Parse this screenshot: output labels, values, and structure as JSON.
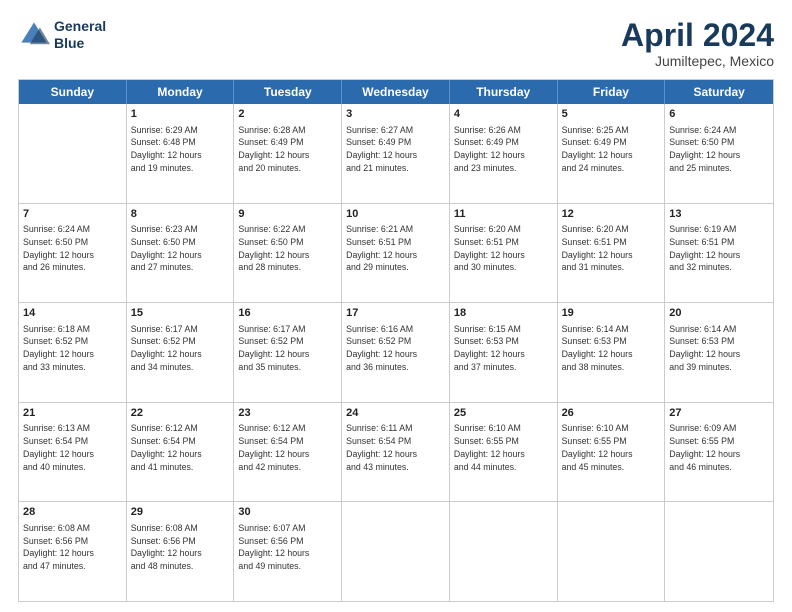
{
  "header": {
    "logo_line1": "General",
    "logo_line2": "Blue",
    "month_title": "April 2024",
    "location": "Jumiltepec, Mexico"
  },
  "day_headers": [
    "Sunday",
    "Monday",
    "Tuesday",
    "Wednesday",
    "Thursday",
    "Friday",
    "Saturday"
  ],
  "weeks": [
    [
      {
        "num": "",
        "info": ""
      },
      {
        "num": "1",
        "info": "Sunrise: 6:29 AM\nSunset: 6:48 PM\nDaylight: 12 hours\nand 19 minutes."
      },
      {
        "num": "2",
        "info": "Sunrise: 6:28 AM\nSunset: 6:49 PM\nDaylight: 12 hours\nand 20 minutes."
      },
      {
        "num": "3",
        "info": "Sunrise: 6:27 AM\nSunset: 6:49 PM\nDaylight: 12 hours\nand 21 minutes."
      },
      {
        "num": "4",
        "info": "Sunrise: 6:26 AM\nSunset: 6:49 PM\nDaylight: 12 hours\nand 23 minutes."
      },
      {
        "num": "5",
        "info": "Sunrise: 6:25 AM\nSunset: 6:49 PM\nDaylight: 12 hours\nand 24 minutes."
      },
      {
        "num": "6",
        "info": "Sunrise: 6:24 AM\nSunset: 6:50 PM\nDaylight: 12 hours\nand 25 minutes."
      }
    ],
    [
      {
        "num": "7",
        "info": "Sunrise: 6:24 AM\nSunset: 6:50 PM\nDaylight: 12 hours\nand 26 minutes."
      },
      {
        "num": "8",
        "info": "Sunrise: 6:23 AM\nSunset: 6:50 PM\nDaylight: 12 hours\nand 27 minutes."
      },
      {
        "num": "9",
        "info": "Sunrise: 6:22 AM\nSunset: 6:50 PM\nDaylight: 12 hours\nand 28 minutes."
      },
      {
        "num": "10",
        "info": "Sunrise: 6:21 AM\nSunset: 6:51 PM\nDaylight: 12 hours\nand 29 minutes."
      },
      {
        "num": "11",
        "info": "Sunrise: 6:20 AM\nSunset: 6:51 PM\nDaylight: 12 hours\nand 30 minutes."
      },
      {
        "num": "12",
        "info": "Sunrise: 6:20 AM\nSunset: 6:51 PM\nDaylight: 12 hours\nand 31 minutes."
      },
      {
        "num": "13",
        "info": "Sunrise: 6:19 AM\nSunset: 6:51 PM\nDaylight: 12 hours\nand 32 minutes."
      }
    ],
    [
      {
        "num": "14",
        "info": "Sunrise: 6:18 AM\nSunset: 6:52 PM\nDaylight: 12 hours\nand 33 minutes."
      },
      {
        "num": "15",
        "info": "Sunrise: 6:17 AM\nSunset: 6:52 PM\nDaylight: 12 hours\nand 34 minutes."
      },
      {
        "num": "16",
        "info": "Sunrise: 6:17 AM\nSunset: 6:52 PM\nDaylight: 12 hours\nand 35 minutes."
      },
      {
        "num": "17",
        "info": "Sunrise: 6:16 AM\nSunset: 6:52 PM\nDaylight: 12 hours\nand 36 minutes."
      },
      {
        "num": "18",
        "info": "Sunrise: 6:15 AM\nSunset: 6:53 PM\nDaylight: 12 hours\nand 37 minutes."
      },
      {
        "num": "19",
        "info": "Sunrise: 6:14 AM\nSunset: 6:53 PM\nDaylight: 12 hours\nand 38 minutes."
      },
      {
        "num": "20",
        "info": "Sunrise: 6:14 AM\nSunset: 6:53 PM\nDaylight: 12 hours\nand 39 minutes."
      }
    ],
    [
      {
        "num": "21",
        "info": "Sunrise: 6:13 AM\nSunset: 6:54 PM\nDaylight: 12 hours\nand 40 minutes."
      },
      {
        "num": "22",
        "info": "Sunrise: 6:12 AM\nSunset: 6:54 PM\nDaylight: 12 hours\nand 41 minutes."
      },
      {
        "num": "23",
        "info": "Sunrise: 6:12 AM\nSunset: 6:54 PM\nDaylight: 12 hours\nand 42 minutes."
      },
      {
        "num": "24",
        "info": "Sunrise: 6:11 AM\nSunset: 6:54 PM\nDaylight: 12 hours\nand 43 minutes."
      },
      {
        "num": "25",
        "info": "Sunrise: 6:10 AM\nSunset: 6:55 PM\nDaylight: 12 hours\nand 44 minutes."
      },
      {
        "num": "26",
        "info": "Sunrise: 6:10 AM\nSunset: 6:55 PM\nDaylight: 12 hours\nand 45 minutes."
      },
      {
        "num": "27",
        "info": "Sunrise: 6:09 AM\nSunset: 6:55 PM\nDaylight: 12 hours\nand 46 minutes."
      }
    ],
    [
      {
        "num": "28",
        "info": "Sunrise: 6:08 AM\nSunset: 6:56 PM\nDaylight: 12 hours\nand 47 minutes."
      },
      {
        "num": "29",
        "info": "Sunrise: 6:08 AM\nSunset: 6:56 PM\nDaylight: 12 hours\nand 48 minutes."
      },
      {
        "num": "30",
        "info": "Sunrise: 6:07 AM\nSunset: 6:56 PM\nDaylight: 12 hours\nand 49 minutes."
      },
      {
        "num": "",
        "info": ""
      },
      {
        "num": "",
        "info": ""
      },
      {
        "num": "",
        "info": ""
      },
      {
        "num": "",
        "info": ""
      }
    ]
  ]
}
